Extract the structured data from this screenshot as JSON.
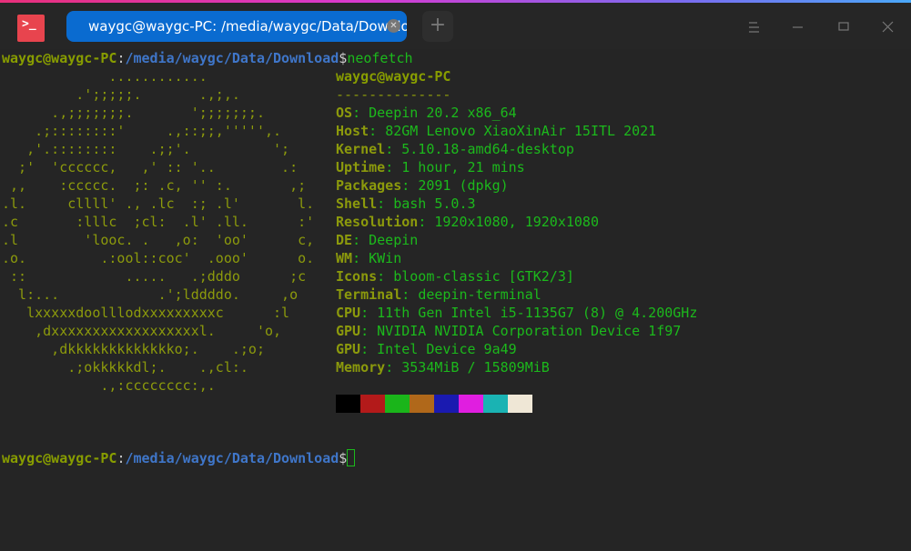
{
  "window": {
    "tab_title": "waygc@waygc-PC: /media/waygc/Data/Download"
  },
  "prompt": {
    "user": "waygc@waygc-PC",
    "sep": ":",
    "path": "/media/waygc/Data/Download",
    "dollar": "$",
    "command": "neofetch"
  },
  "ascii": [
    "             ............",
    "         .';;;;;.       .,;,.",
    "      .,;;;;;;;.       ';;;;;;;.",
    "    .;::::::::'     .,::;;,''''',.",
    "   ,'.::::::::    .;;'.          ';",
    "  ;'  'cccccc,   ,' :: '..        .:",
    " ,,    :ccccc.  ;: .c, '' :.       ,;",
    ".l.     cllll' ., .lc  :; .l'       l.",
    ".c       :lllc  ;cl:  .l' .ll.      :'",
    ".l        'looc. .   ,o:  'oo'      c,",
    ".o.         .:ool::coc'  .ooo'      o.",
    " ::            .....   .;dddo      ;c",
    "  l:...            .';lddddo.     ,o",
    "   lxxxxxdoolllodxxxxxxxxxc      :l",
    "    ,dxxxxxxxxxxxxxxxxxxl.     'o,",
    "      ,dkkkkkkkkkkkkko;.    .;o;",
    "        .;okkkkkdl;.    .,cl:.",
    "            .,:cccccccc:,."
  ],
  "info": {
    "title": "waygc@waygc-PC",
    "underline": "--------------",
    "items": [
      {
        "key": "OS",
        "value": "Deepin 20.2 x86_64"
      },
      {
        "key": "Host",
        "value": "82GM Lenovo XiaoXinAir 15ITL 2021"
      },
      {
        "key": "Kernel",
        "value": "5.10.18-amd64-desktop"
      },
      {
        "key": "Uptime",
        "value": "1 hour, 21 mins"
      },
      {
        "key": "Packages",
        "value": "2091 (dpkg)"
      },
      {
        "key": "Shell",
        "value": "bash 5.0.3"
      },
      {
        "key": "Resolution",
        "value": "1920x1080, 1920x1080"
      },
      {
        "key": "DE",
        "value": "Deepin"
      },
      {
        "key": "WM",
        "value": "KWin"
      },
      {
        "key": "Icons",
        "value": "bloom-classic [GTK2/3]"
      },
      {
        "key": "Terminal",
        "value": "deepin-terminal"
      },
      {
        "key": "CPU",
        "value": "11th Gen Intel i5-1135G7 (8) @ 4.200GHz"
      },
      {
        "key": "GPU",
        "value": "NVIDIA NVIDIA Corporation Device 1f97"
      },
      {
        "key": "GPU",
        "value": "Intel Device 9a49"
      },
      {
        "key": "Memory",
        "value": "3534MiB / 15809MiB"
      }
    ]
  },
  "palette": [
    "#000000",
    "#b31a1a",
    "#1ab51a",
    "#b0681a",
    "#1a1ab0",
    "#e01ee0",
    "#1ab3b3",
    "#efe7d6"
  ]
}
